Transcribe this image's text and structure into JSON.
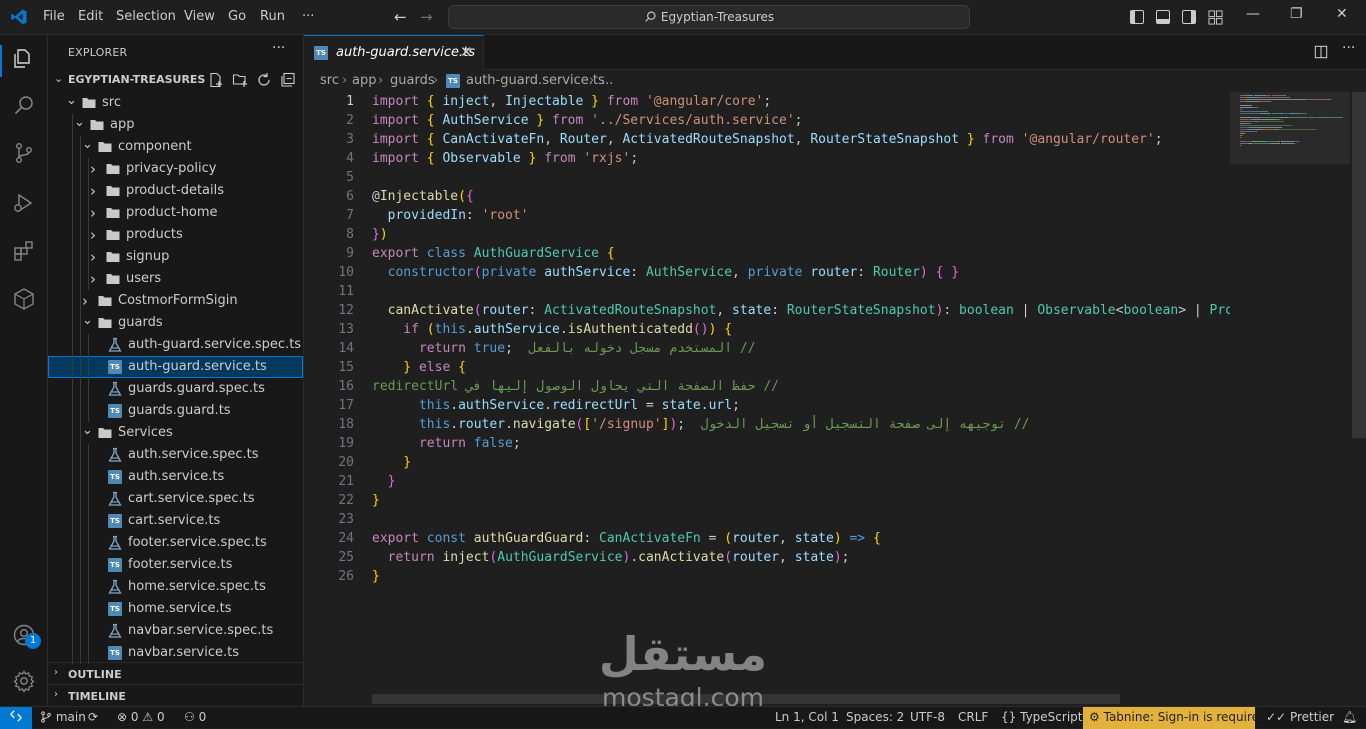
{
  "menu": [
    "File",
    "Edit",
    "Selection",
    "View",
    "Go",
    "Run",
    "···"
  ],
  "search": {
    "text": "Egyptian-Treasures"
  },
  "window_controls": {
    "minimize": "—",
    "restore": "❐",
    "close": "✕"
  },
  "sidebar": {
    "title": "EXPLORER",
    "more": "···",
    "project_name": "EGYPTIAN-TREASURES",
    "tree": [
      {
        "label": "src",
        "type": "folder",
        "depth": 0,
        "open": true
      },
      {
        "label": "app",
        "type": "folder",
        "depth": 1,
        "open": true
      },
      {
        "label": "component",
        "type": "folder",
        "depth": 2,
        "open": true
      },
      {
        "label": "privacy-policy",
        "type": "folder",
        "depth": 3,
        "open": false
      },
      {
        "label": "product-details",
        "type": "folder",
        "depth": 3,
        "open": false
      },
      {
        "label": "product-home",
        "type": "folder",
        "depth": 3,
        "open": false
      },
      {
        "label": "products",
        "type": "folder",
        "depth": 3,
        "open": false
      },
      {
        "label": "signup",
        "type": "folder",
        "depth": 3,
        "open": false
      },
      {
        "label": "users",
        "type": "folder",
        "depth": 3,
        "open": false
      },
      {
        "label": "CostmorFormSigin",
        "type": "folder",
        "depth": 2,
        "open": false
      },
      {
        "label": "guards",
        "type": "folder",
        "depth": 2,
        "open": true
      },
      {
        "label": "auth-guard.service.spec.ts",
        "type": "spec",
        "depth": 3
      },
      {
        "label": "auth-guard.service.ts",
        "type": "ts",
        "depth": 3,
        "selected": true
      },
      {
        "label": "guards.guard.spec.ts",
        "type": "spec",
        "depth": 3
      },
      {
        "label": "guards.guard.ts",
        "type": "ts",
        "depth": 3
      },
      {
        "label": "Services",
        "type": "folder",
        "depth": 2,
        "open": true
      },
      {
        "label": "auth.service.spec.ts",
        "type": "spec",
        "depth": 3
      },
      {
        "label": "auth.service.ts",
        "type": "ts",
        "depth": 3
      },
      {
        "label": "cart.service.spec.ts",
        "type": "spec",
        "depth": 3
      },
      {
        "label": "cart.service.ts",
        "type": "ts",
        "depth": 3
      },
      {
        "label": "footer.service.spec.ts",
        "type": "spec",
        "depth": 3
      },
      {
        "label": "footer.service.ts",
        "type": "ts",
        "depth": 3
      },
      {
        "label": "home.service.spec.ts",
        "type": "spec",
        "depth": 3
      },
      {
        "label": "home.service.ts",
        "type": "ts",
        "depth": 3
      },
      {
        "label": "navbar.service.spec.ts",
        "type": "spec",
        "depth": 3
      },
      {
        "label": "navbar.service.ts",
        "type": "ts",
        "depth": 3
      }
    ],
    "outline": "OUTLINE",
    "timeline": "TIMELINE"
  },
  "account_badge": "1",
  "tab": {
    "label": "auth-guard.service.ts",
    "close": "✕",
    "icon": "TS"
  },
  "breadcrumb": [
    "src",
    "app",
    "guards",
    "auth-guard.service.ts",
    "..."
  ],
  "editor": {
    "line_numbers": [
      "1",
      "2",
      "3",
      "4",
      "5",
      "6",
      "7",
      "8",
      "9",
      "10",
      "11",
      "12",
      "13",
      "14",
      "15",
      "16",
      "17",
      "18",
      "19",
      "20",
      "21",
      "22",
      "23",
      "24",
      "25",
      "26"
    ],
    "current_line": 1,
    "colors": {
      "keyword": "#569cd6",
      "control": "#c586c0",
      "string": "#ce9178",
      "type": "#4ec9b0",
      "variable": "#9cdcfe",
      "function": "#dcdcaa",
      "comment": "#6a9955",
      "brace": "#ffd700",
      "paren": "#da70d6",
      "text": "#cccccc"
    },
    "lines": [
      [
        [
          "import ",
          "control"
        ],
        [
          "{ ",
          "brace"
        ],
        [
          "inject",
          "variable"
        ],
        [
          ", ",
          "text"
        ],
        [
          "Injectable",
          "variable"
        ],
        [
          " }",
          "brace"
        ],
        [
          " from ",
          "control"
        ],
        [
          "'@angular/core'",
          "string"
        ],
        [
          ";",
          "text"
        ]
      ],
      [
        [
          "import ",
          "control"
        ],
        [
          "{ ",
          "brace"
        ],
        [
          "AuthService",
          "variable"
        ],
        [
          " }",
          "brace"
        ],
        [
          " from ",
          "control"
        ],
        [
          "'../Services/auth.service'",
          "string"
        ],
        [
          ";",
          "text"
        ]
      ],
      [
        [
          "import ",
          "control"
        ],
        [
          "{ ",
          "brace"
        ],
        [
          "CanActivateFn",
          "variable"
        ],
        [
          ", ",
          "text"
        ],
        [
          "Router",
          "variable"
        ],
        [
          ", ",
          "text"
        ],
        [
          "ActivatedRouteSnapshot",
          "variable"
        ],
        [
          ", ",
          "text"
        ],
        [
          "RouterStateSnapshot",
          "variable"
        ],
        [
          " }",
          "brace"
        ],
        [
          " from ",
          "control"
        ],
        [
          "'@angular/router'",
          "string"
        ],
        [
          ";",
          "text"
        ]
      ],
      [
        [
          "import ",
          "control"
        ],
        [
          "{ ",
          "brace"
        ],
        [
          "Observable",
          "variable"
        ],
        [
          " }",
          "brace"
        ],
        [
          " from ",
          "control"
        ],
        [
          "'rxjs'",
          "string"
        ],
        [
          ";",
          "text"
        ]
      ],
      [],
      [
        [
          "@",
          "text"
        ],
        [
          "Injectable",
          "function"
        ],
        [
          "(",
          "brace"
        ],
        [
          "{",
          "paren"
        ]
      ],
      [
        [
          "  providedIn",
          "variable"
        ],
        [
          ": ",
          "text"
        ],
        [
          "'root'",
          "string"
        ]
      ],
      [
        [
          "}",
          "paren"
        ],
        [
          ")",
          "brace"
        ]
      ],
      [
        [
          "export ",
          "control"
        ],
        [
          "class ",
          "keyword"
        ],
        [
          "AuthGuardService ",
          "type"
        ],
        [
          "{",
          "brace"
        ]
      ],
      [
        [
          "  constructor",
          "keyword"
        ],
        [
          "(",
          "paren"
        ],
        [
          "private ",
          "keyword"
        ],
        [
          "authService",
          "variable"
        ],
        [
          ": ",
          "text"
        ],
        [
          "AuthService",
          "type"
        ],
        [
          ", ",
          "text"
        ],
        [
          "private ",
          "keyword"
        ],
        [
          "router",
          "variable"
        ],
        [
          ": ",
          "text"
        ],
        [
          "Router",
          "type"
        ],
        [
          ")",
          "paren"
        ],
        [
          " { }",
          "paren"
        ]
      ],
      [],
      [
        [
          "  canActivate",
          "function"
        ],
        [
          "(",
          "paren"
        ],
        [
          "router",
          "variable"
        ],
        [
          ": ",
          "text"
        ],
        [
          "ActivatedRouteSnapshot",
          "type"
        ],
        [
          ", ",
          "text"
        ],
        [
          "state",
          "variable"
        ],
        [
          ": ",
          "text"
        ],
        [
          "RouterStateSnapshot",
          "type"
        ],
        [
          ")",
          "paren"
        ],
        [
          ": ",
          "text"
        ],
        [
          "boolean ",
          "type"
        ],
        [
          "| ",
          "text"
        ],
        [
          "Observable",
          "type"
        ],
        [
          "<",
          "text"
        ],
        [
          "boolean",
          "type"
        ],
        [
          "> ",
          "text"
        ],
        [
          "| ",
          "text"
        ],
        [
          "Promise",
          "type"
        ]
      ],
      [
        [
          "    if ",
          "control"
        ],
        [
          "(",
          "brace"
        ],
        [
          "this",
          "keyword"
        ],
        [
          ".",
          "text"
        ],
        [
          "authService",
          "variable"
        ],
        [
          ".",
          "text"
        ],
        [
          "isAuthenticatedd",
          "function"
        ],
        [
          "()",
          "paren"
        ],
        [
          ") ",
          "brace"
        ],
        [
          "{",
          "brace"
        ]
      ],
      [
        [
          "      return ",
          "control"
        ],
        [
          "true",
          "keyword"
        ],
        [
          ";  ",
          "text"
        ],
        [
          "// المستخدم مسجل دخوله بالفعل",
          "comment"
        ]
      ],
      [
        [
          "    } ",
          "brace"
        ],
        [
          "else ",
          "control"
        ],
        [
          "{",
          "brace"
        ]
      ],
      [
        [
          "      // حفظ الصفحة التي يحاول الوصول إليها في redirectUrl",
          "comment"
        ]
      ],
      [
        [
          "      this",
          "keyword"
        ],
        [
          ".",
          "text"
        ],
        [
          "authService",
          "variable"
        ],
        [
          ".",
          "text"
        ],
        [
          "redirectUrl",
          "variable"
        ],
        [
          " = ",
          "text"
        ],
        [
          "state",
          "variable"
        ],
        [
          ".",
          "text"
        ],
        [
          "url",
          "variable"
        ],
        [
          ";",
          "text"
        ]
      ],
      [
        [
          "      this",
          "keyword"
        ],
        [
          ".",
          "text"
        ],
        [
          "router",
          "variable"
        ],
        [
          ".",
          "text"
        ],
        [
          "navigate",
          "function"
        ],
        [
          "(",
          "paren"
        ],
        [
          "[",
          "brace"
        ],
        [
          "'/signup'",
          "string"
        ],
        [
          "]",
          "brace"
        ],
        [
          ")",
          "paren"
        ],
        [
          ";  ",
          "text"
        ],
        [
          "// توجيهه إلى صفحة التسجيل أو تسجيل الدخول",
          "comment"
        ]
      ],
      [
        [
          "      return ",
          "control"
        ],
        [
          "false",
          "keyword"
        ],
        [
          ";",
          "text"
        ]
      ],
      [
        [
          "    }",
          "brace"
        ]
      ],
      [
        [
          "  }",
          "paren"
        ]
      ],
      [
        [
          "}",
          "brace"
        ]
      ],
      [],
      [
        [
          "export ",
          "control"
        ],
        [
          "const ",
          "keyword"
        ],
        [
          "authGuardGuard",
          "function"
        ],
        [
          ": ",
          "text"
        ],
        [
          "CanActivateFn",
          "type"
        ],
        [
          " = ",
          "text"
        ],
        [
          "(",
          "brace"
        ],
        [
          "router",
          "variable"
        ],
        [
          ", ",
          "text"
        ],
        [
          "state",
          "variable"
        ],
        [
          ")",
          "brace"
        ],
        [
          " => ",
          "keyword"
        ],
        [
          "{",
          "brace"
        ]
      ],
      [
        [
          "  return ",
          "control"
        ],
        [
          "inject",
          "function"
        ],
        [
          "(",
          "paren"
        ],
        [
          "AuthGuardService",
          "type"
        ],
        [
          ")",
          "paren"
        ],
        [
          ".",
          "text"
        ],
        [
          "canActivate",
          "function"
        ],
        [
          "(",
          "paren"
        ],
        [
          "router",
          "variable"
        ],
        [
          ", ",
          "text"
        ],
        [
          "state",
          "variable"
        ],
        [
          ")",
          "paren"
        ],
        [
          ";",
          "text"
        ]
      ],
      [
        [
          "}",
          "brace"
        ]
      ]
    ]
  },
  "watermark": {
    "arabic": "مستقل",
    "latin": "mostaql.com"
  },
  "status": {
    "branch": "main",
    "errors": "0",
    "warnings": "0",
    "ports": "0",
    "position": "Ln 1, Col 1",
    "spaces": "Spaces: 2",
    "encoding": "UTF-8",
    "eol": "CRLF",
    "language": "TypeScript",
    "tabnine": "Tabnine: Sign-in is required",
    "prettier": "Prettier",
    "tabnine_color": "#e3b23c",
    "accent": "#0078d4"
  }
}
